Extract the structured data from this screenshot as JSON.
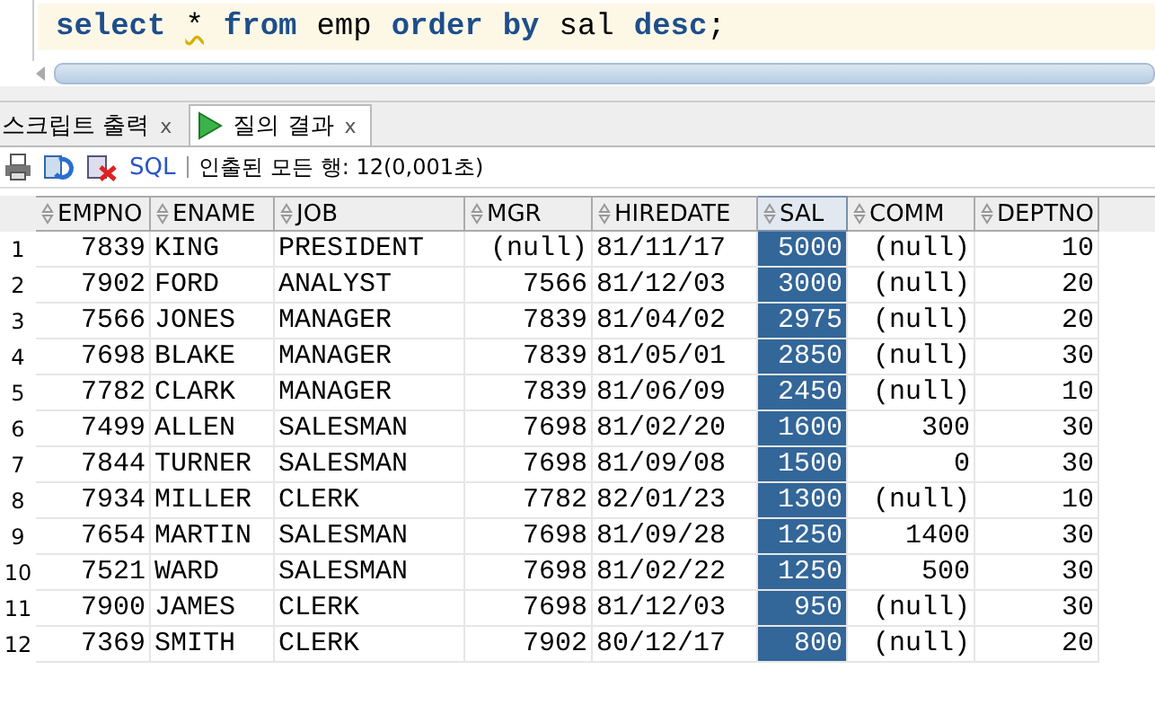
{
  "editor": {
    "tokens": [
      {
        "text": "select",
        "kind": "keyword"
      },
      {
        "text": "*",
        "kind": "plain",
        "warning": true
      },
      {
        "text": "from",
        "kind": "keyword"
      },
      {
        "text": "emp",
        "kind": "plain"
      },
      {
        "text": "order",
        "kind": "keyword"
      },
      {
        "text": "by",
        "kind": "keyword"
      },
      {
        "text": "sal",
        "kind": "plain"
      },
      {
        "text": "desc",
        "kind": "keyword"
      },
      {
        "text": ";",
        "kind": "plain"
      }
    ]
  },
  "tabs": [
    {
      "label": "스크립트 출력",
      "close": "x",
      "selected": false,
      "icon": false
    },
    {
      "label": "질의 결과",
      "close": "x",
      "selected": true,
      "icon": true
    }
  ],
  "toolbar": {
    "sql_link": "SQL",
    "status": "인출된 모든 행: 12(0,001초)"
  },
  "table": {
    "columns": [
      {
        "label": "EMPNO",
        "kind": "number",
        "selected": false
      },
      {
        "label": "ENAME",
        "kind": "text",
        "selected": false
      },
      {
        "label": "JOB",
        "kind": "text",
        "selected": false
      },
      {
        "label": "MGR",
        "kind": "number",
        "selected": false
      },
      {
        "label": "HIREDATE",
        "kind": "text",
        "selected": false
      },
      {
        "label": "SAL",
        "kind": "number",
        "selected": true
      },
      {
        "label": "COMM",
        "kind": "number",
        "selected": false
      },
      {
        "label": "DEPTNO",
        "kind": "number",
        "selected": false
      }
    ],
    "rows": [
      {
        "num": "1",
        "cells": [
          "7839",
          "KING",
          "PRESIDENT",
          "(null)",
          "81/11/17",
          "5000",
          "(null)",
          "10"
        ]
      },
      {
        "num": "2",
        "cells": [
          "7902",
          "FORD",
          "ANALYST",
          "7566",
          "81/12/03",
          "3000",
          "(null)",
          "20"
        ]
      },
      {
        "num": "3",
        "cells": [
          "7566",
          "JONES",
          "MANAGER",
          "7839",
          "81/04/02",
          "2975",
          "(null)",
          "20"
        ]
      },
      {
        "num": "4",
        "cells": [
          "7698",
          "BLAKE",
          "MANAGER",
          "7839",
          "81/05/01",
          "2850",
          "(null)",
          "30"
        ]
      },
      {
        "num": "5",
        "cells": [
          "7782",
          "CLARK",
          "MANAGER",
          "7839",
          "81/06/09",
          "2450",
          "(null)",
          "10"
        ]
      },
      {
        "num": "6",
        "cells": [
          "7499",
          "ALLEN",
          "SALESMAN",
          "7698",
          "81/02/20",
          "1600",
          "300",
          "30"
        ]
      },
      {
        "num": "7",
        "cells": [
          "7844",
          "TURNER",
          "SALESMAN",
          "7698",
          "81/09/08",
          "1500",
          "0",
          "30"
        ]
      },
      {
        "num": "8",
        "cells": [
          "7934",
          "MILLER",
          "CLERK",
          "7782",
          "82/01/23",
          "1300",
          "(null)",
          "10"
        ]
      },
      {
        "num": "9",
        "cells": [
          "7654",
          "MARTIN",
          "SALESMAN",
          "7698",
          "81/09/28",
          "1250",
          "1400",
          "30"
        ]
      },
      {
        "num": "10",
        "cells": [
          "7521",
          "WARD",
          "SALESMAN",
          "7698",
          "81/02/22",
          "1250",
          "500",
          "30"
        ]
      },
      {
        "num": "11",
        "cells": [
          "7900",
          "JAMES",
          "CLERK",
          "7698",
          "81/12/03",
          "950",
          "(null)",
          "30"
        ]
      },
      {
        "num": "12",
        "cells": [
          "7369",
          "SMITH",
          "CLERK",
          "7902",
          "80/12/17",
          "800",
          "(null)",
          "20"
        ]
      }
    ]
  }
}
